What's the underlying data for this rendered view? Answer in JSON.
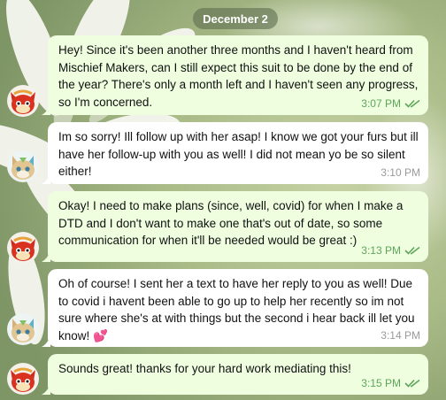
{
  "conversation": {
    "date_separator": "December 2",
    "messages": [
      {
        "direction": "out",
        "text": "Hey! Since it's been another three months and I haven't heard from Mischief Makers, can I still expect this suit to be done by the end of the year? There's only a month left and I haven't seen any progress, so I'm concerned.",
        "time": "3:07 PM",
        "read": true
      },
      {
        "direction": "in",
        "text": "Im so sorry! Ill follow up with her asap! I know we got your furs but ill have her follow-up with you as well! I did not mean yo be so silent either!",
        "time": "3:10 PM"
      },
      {
        "direction": "out",
        "text": "Okay! I need to make plans (since, well, covid) for when I make a DTD and I don't want to make one that's out of date, so some communication for when it'll be needed would be great :)",
        "time": "3:13 PM",
        "read": true
      },
      {
        "direction": "in",
        "text": "Oh of course! I sent her a text to have her reply to you as well! Due to covid i havent been able to go up to help her recently so im not sure where she's at with things but the second i hear back ill let you know! 💕",
        "time": "3:14 PM"
      },
      {
        "direction": "out",
        "text": "Sounds great! thanks for your hard work mediating this!",
        "time": "3:15 PM",
        "read": true
      }
    ]
  },
  "colors": {
    "outgoing_bubble": "#eefedf",
    "incoming_bubble": "#ffffff",
    "outgoing_time": "#5ea55a",
    "incoming_time": "#9a9a9a",
    "date_pill": "#607050"
  },
  "icons": {
    "read_receipt": "double-check-icon",
    "sender_avatar": "red-fox-character-avatar",
    "recipient_avatar": "tan-cat-character-avatar"
  }
}
